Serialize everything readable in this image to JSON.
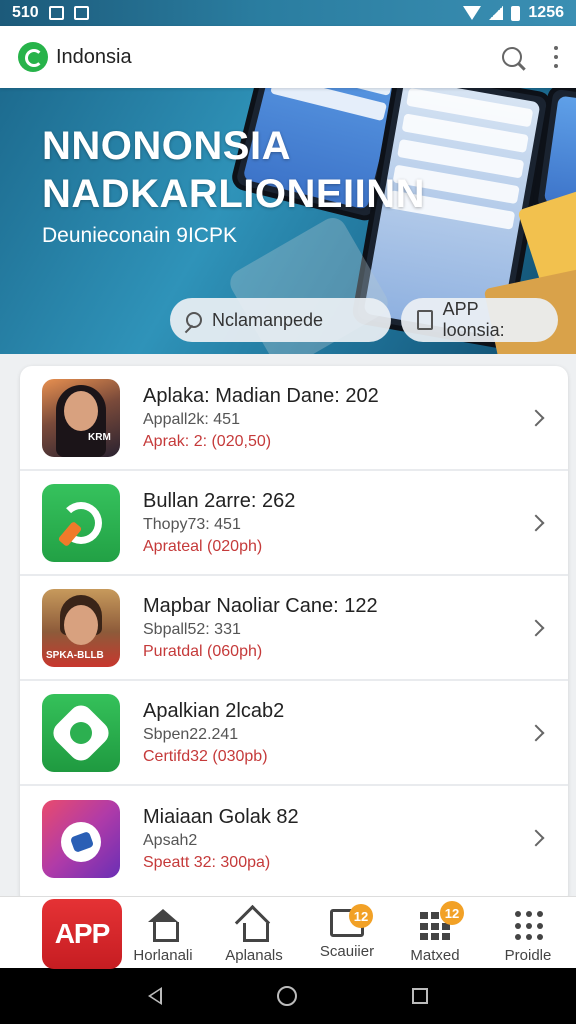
{
  "status_bar": {
    "time": "510",
    "clock": "1256"
  },
  "app_bar": {
    "title": "Indonsia"
  },
  "hero": {
    "title_line1": "NNONONSIA",
    "title_line2": "NADKARLIONEIINN",
    "subtitle": "Deunieconain 9ICPK",
    "pill_left": "Nclamanpede",
    "pill_right": "APP loonsia:"
  },
  "list": [
    {
      "title": "Aplaka: Madian Dane: 202",
      "sub": "Appall2k: 451",
      "price": "Aprak: 2: (020,50)",
      "thumb_caption": "KRM"
    },
    {
      "title": "Bullan 2arre: 262",
      "sub": "Thopy73: 451",
      "price": "Aprateal (020ph)"
    },
    {
      "title": "Mapbar Naoliar Cane: 122",
      "sub": "Sbpall52: 331",
      "price": "Puratdal (060ph)",
      "thumb_caption": "SPKA-BLLB"
    },
    {
      "title": "Apalkian 2lcab2",
      "sub": "Sbpen22.241",
      "price": "Certifd32 (030pb)"
    },
    {
      "title": "Miaiaan Golak 82",
      "sub": "Apsah2",
      "price": "Speatt 32: 300pa)"
    }
  ],
  "bottom_nav": {
    "app_button": "APP",
    "items": [
      {
        "label": "Horlanali"
      },
      {
        "label": "Aplanals"
      },
      {
        "label": "Scauiier",
        "badge": "12"
      },
      {
        "label": "Matxed",
        "badge": "12"
      },
      {
        "label": "Proidle"
      }
    ]
  },
  "colors": {
    "accent_red": "#c53a3a",
    "brand_green": "#27b34a",
    "badge": "#f2a126"
  }
}
